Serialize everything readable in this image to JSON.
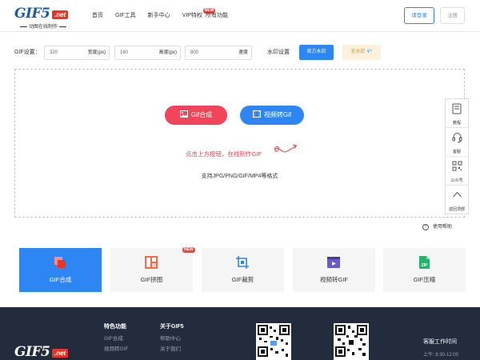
{
  "header": {
    "logo_main": "GIF5",
    "logo_net": ".net",
    "logo_sub": "动图在线制作",
    "nav": [
      "首页",
      "GIF工具",
      "新手中心",
      "VIP特权",
      "所有功能"
    ],
    "vip_badge": "NEW",
    "login": "请登录",
    "register": "注册"
  },
  "settings": {
    "label": "GIF设置：",
    "width_value": "320",
    "width_unit": "宽度(px)",
    "height_value": "160",
    "height_unit": "高度(px)",
    "speed_value": "800",
    "speed_unit": "速度",
    "watermark_label": "水印设置",
    "official_watermark": "官方水印",
    "no_watermark": "无水印 💎"
  },
  "upload": {
    "gif_button": "Gif合成",
    "video_button": "视频转Gif",
    "hint": "点击上方按钮，在线制作GIF",
    "support": "支持JPG/PNG/GIF/MP4等格式"
  },
  "sidebar": [
    "教程",
    "客服",
    "公众号",
    "返回顶部"
  ],
  "help": "使用帮助",
  "tools": {
    "items": [
      "GIF合成",
      "GIF拼图",
      "GIF裁剪",
      "视频转GIF",
      "GIF压缩"
    ],
    "new_badge": "NEW",
    "zip_text": "ZIP"
  },
  "colors": {
    "primary": "#2e86f5",
    "accent_red": "#f2455b",
    "footer_bg": "#232c3d"
  },
  "footer": {
    "logo_main": "GIF5",
    "logo_net": ".net",
    "features_head": "特色功能",
    "features": [
      "GIF合成",
      "视频转GIF"
    ],
    "about_head": "关于GIF5",
    "about": [
      "帮助中心",
      "关于我们"
    ],
    "service_title": "客服工作时间",
    "service_time": "上午: 8:30-12:00"
  }
}
